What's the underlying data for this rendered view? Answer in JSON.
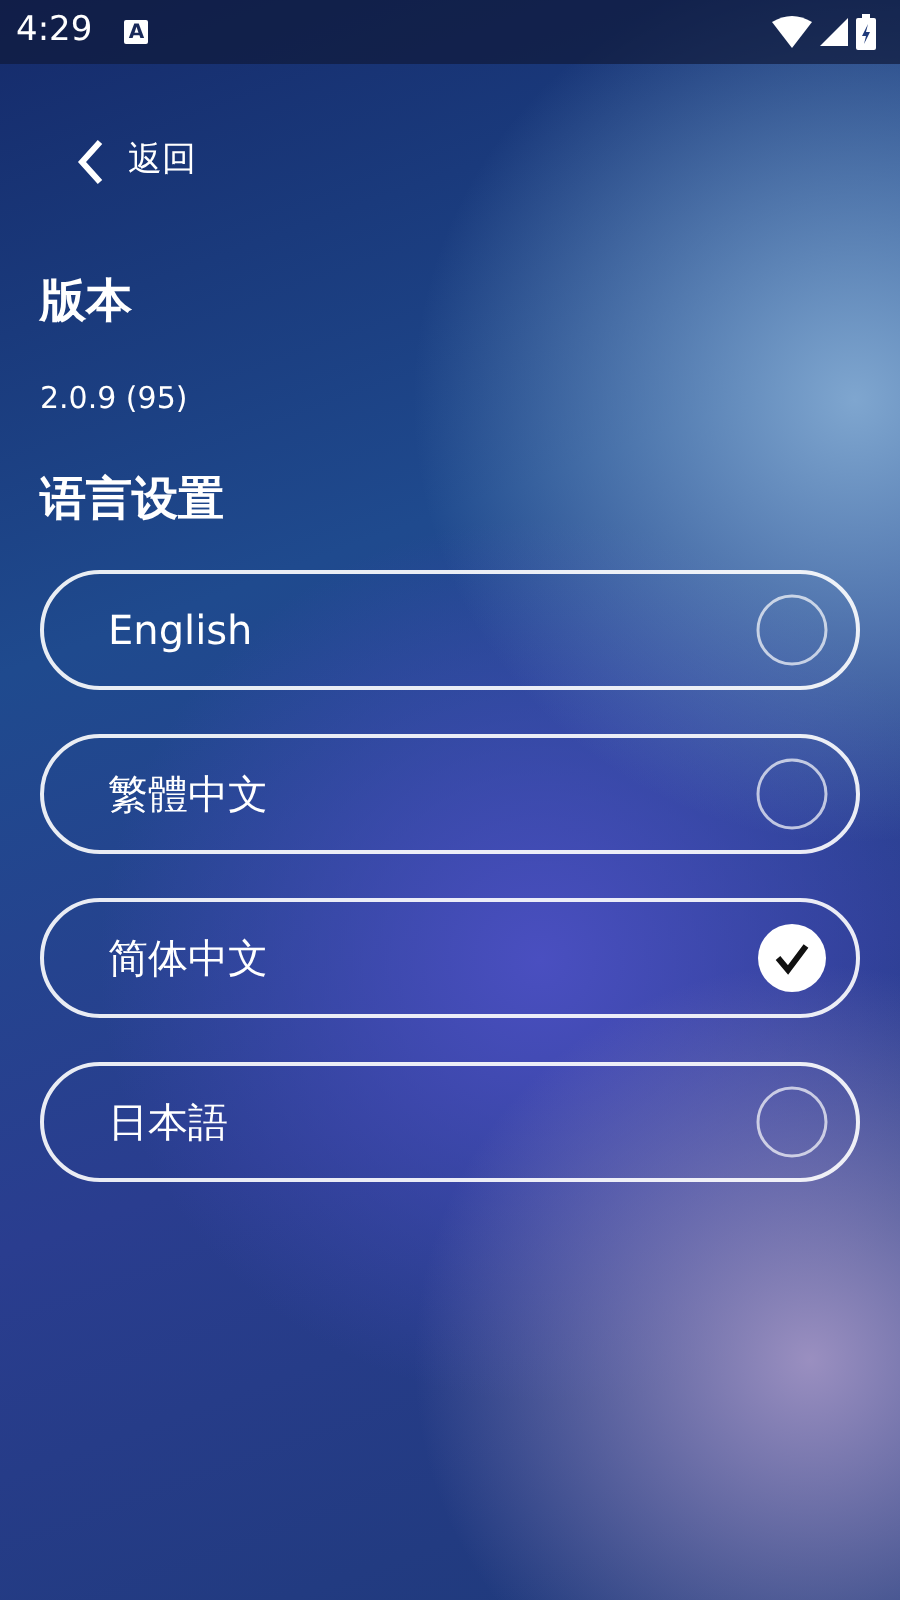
{
  "status_bar": {
    "time": "4:29",
    "notification_letter": "A"
  },
  "back": {
    "label": "返回"
  },
  "version": {
    "title": "版本",
    "value": "2.0.9 (95)"
  },
  "language": {
    "title": "语言设置",
    "options": [
      {
        "label": "English",
        "selected": false
      },
      {
        "label": "繁體中文",
        "selected": false
      },
      {
        "label": "简体中文",
        "selected": true
      },
      {
        "label": "日本語",
        "selected": false
      }
    ]
  }
}
